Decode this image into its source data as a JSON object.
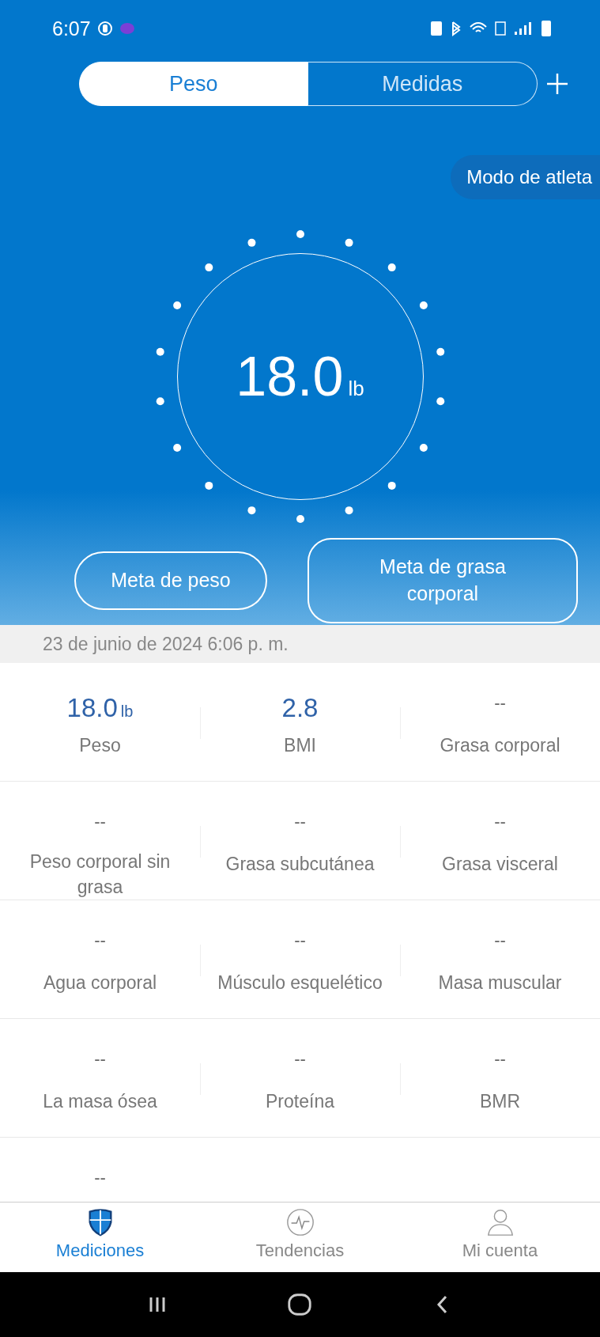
{
  "status_bar": {
    "time": "6:07"
  },
  "tabs": [
    {
      "label": "Peso",
      "selected": true
    },
    {
      "label": "Medidas",
      "selected": false
    }
  ],
  "athlete_mode": {
    "label": "Modo de atleta"
  },
  "gauge": {
    "value": "18.0",
    "unit": "lb"
  },
  "goal_buttons": [
    "Meta de peso",
    "Meta de grasa corporal"
  ],
  "date": "23 de junio de 2024 6:06 p. m.",
  "metrics": [
    {
      "value": "18.0",
      "unit": "lb",
      "label": "Peso",
      "measured": true
    },
    {
      "value": "2.8",
      "label": "BMI",
      "measured": true
    },
    {
      "value": "--",
      "label": "Grasa corporal",
      "measured": false
    },
    {
      "value": "--",
      "label": "Peso corporal sin grasa",
      "measured": false
    },
    {
      "value": "--",
      "label": "Grasa subcutánea",
      "measured": false
    },
    {
      "value": "--",
      "label": "Grasa visceral",
      "measured": false
    },
    {
      "value": "--",
      "label": "Agua corporal",
      "measured": false
    },
    {
      "value": "--",
      "label": "Músculo esquelético",
      "measured": false
    },
    {
      "value": "--",
      "label": "Masa muscular",
      "measured": false
    },
    {
      "value": "--",
      "label": "La masa ósea",
      "measured": false
    },
    {
      "value": "--",
      "label": "Proteína",
      "measured": false
    },
    {
      "value": "--",
      "label": "BMR",
      "measured": false
    },
    {
      "value": "--",
      "measured": false
    }
  ],
  "bottom_nav": [
    {
      "label": "Mediciones",
      "selected": true,
      "kind": "shield"
    },
    {
      "label": "Tendencias",
      "selected": false,
      "kind": "pulse"
    },
    {
      "label": "Mi cuenta",
      "selected": false,
      "kind": "person"
    }
  ]
}
